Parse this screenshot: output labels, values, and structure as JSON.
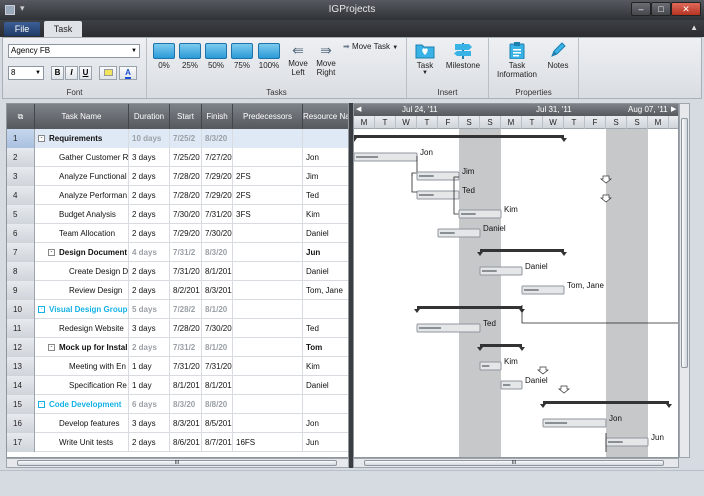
{
  "window": {
    "title": "IGProjects"
  },
  "tabs": {
    "file": "File",
    "task": "Task"
  },
  "ribbon": {
    "font": {
      "name": "Agency FB",
      "size": "8",
      "bold": "B",
      "italic": "I",
      "underline": "U",
      "group_label": "Font"
    },
    "tasks": {
      "buttons": [
        "0%",
        "25%",
        "50%",
        "75%",
        "100%"
      ],
      "move_left": [
        "Move",
        "Left"
      ],
      "move_right": [
        "Move",
        "Right"
      ],
      "move_task": "Move Task",
      "group_label": "Tasks"
    },
    "insert": {
      "task": "Task",
      "milestone": "Milestone",
      "group_label": "Insert"
    },
    "properties": {
      "task_info": [
        "Task",
        "Information"
      ],
      "notes": "Notes",
      "group_label": "Properties"
    }
  },
  "grid": {
    "columns": [
      "Task Name",
      "Duration",
      "Start",
      "Finish",
      "Predecessors",
      "Resource Na"
    ],
    "rows": [
      {
        "n": "1",
        "name": "Requirements",
        "dur": "10 days",
        "start": "7/25/2",
        "finish": "8/3/20",
        "pred": "",
        "res": "",
        "kind": "summary",
        "indent": 0,
        "exp": "-"
      },
      {
        "n": "2",
        "name": "Gather Customer R",
        "dur": "3 days",
        "start": "7/25/20",
        "finish": "7/27/20",
        "pred": "",
        "res": "Jon",
        "kind": "task",
        "indent": 1
      },
      {
        "n": "3",
        "name": "Analyze Functional",
        "dur": "2 days",
        "start": "7/28/20",
        "finish": "7/29/20",
        "pred": "2FS",
        "res": "Jim",
        "kind": "task",
        "indent": 1
      },
      {
        "n": "4",
        "name": "Analyze Performan",
        "dur": "2 days",
        "start": "7/28/20",
        "finish": "7/29/20",
        "pred": "2FS",
        "res": "Ted",
        "kind": "task",
        "indent": 1
      },
      {
        "n": "5",
        "name": "Budget Analysis",
        "dur": "2 days",
        "start": "7/30/20",
        "finish": "7/31/20",
        "pred": "3FS",
        "res": "Kim",
        "kind": "task",
        "indent": 1
      },
      {
        "n": "6",
        "name": "Team Allocation",
        "dur": "2 days",
        "start": "7/29/20",
        "finish": "7/30/20",
        "pred": "",
        "res": "Daniel",
        "kind": "task",
        "indent": 1
      },
      {
        "n": "7",
        "name": "Design Document",
        "dur": "4 days",
        "start": "7/31/2",
        "finish": "8/3/20",
        "pred": "",
        "res": "Jun",
        "kind": "summary",
        "indent": 1,
        "exp": "-"
      },
      {
        "n": "8",
        "name": "Create Design D",
        "dur": "2 days",
        "start": "7/31/20",
        "finish": "8/1/201",
        "pred": "",
        "res": "Daniel",
        "kind": "task",
        "indent": 2
      },
      {
        "n": "9",
        "name": "Review Design",
        "dur": "2 days",
        "start": "8/2/201",
        "finish": "8/3/201",
        "pred": "",
        "res": "Tom, Jane",
        "kind": "task",
        "indent": 2
      },
      {
        "n": "10",
        "name": "Visual Design Group",
        "dur": "5 days",
        "start": "7/28/2",
        "finish": "8/1/20",
        "pred": "",
        "res": "",
        "kind": "group",
        "indent": 0,
        "exp": "-"
      },
      {
        "n": "11",
        "name": "Redesign Website",
        "dur": "3 days",
        "start": "7/28/20",
        "finish": "7/30/20",
        "pred": "",
        "res": "Ted",
        "kind": "task",
        "indent": 1
      },
      {
        "n": "12",
        "name": "Mock up for Install",
        "dur": "2 days",
        "start": "7/31/2",
        "finish": "8/1/20",
        "pred": "",
        "res": "Tom",
        "kind": "summary",
        "indent": 1,
        "exp": "-"
      },
      {
        "n": "13",
        "name": "Meeting with En",
        "dur": "1 day",
        "start": "7/31/20",
        "finish": "7/31/20",
        "pred": "",
        "res": "Kim",
        "kind": "task",
        "indent": 2
      },
      {
        "n": "14",
        "name": "Specification Re",
        "dur": "1 day",
        "start": "8/1/201",
        "finish": "8/1/201",
        "pred": "",
        "res": "Daniel",
        "kind": "task",
        "indent": 2
      },
      {
        "n": "15",
        "name": "Code Development",
        "dur": "6 days",
        "start": "8/3/20",
        "finish": "8/8/20",
        "pred": "",
        "res": "",
        "kind": "group",
        "indent": 0,
        "exp": "-"
      },
      {
        "n": "16",
        "name": "Develop features",
        "dur": "3 days",
        "start": "8/3/201",
        "finish": "8/5/201",
        "pred": "",
        "res": "Jon",
        "kind": "task",
        "indent": 1
      },
      {
        "n": "17",
        "name": "Write Unit tests",
        "dur": "2 days",
        "start": "8/6/201",
        "finish": "8/7/201",
        "pred": "16FS",
        "res": "Jun",
        "kind": "task",
        "indent": 1
      }
    ]
  },
  "gantt": {
    "weeks": [
      "Jul 24, '11",
      "Jul 31, '11",
      "Aug 07, '11"
    ],
    "days": [
      "M",
      "T",
      "W",
      "T",
      "F",
      "S",
      "S",
      "M",
      "T",
      "W",
      "T",
      "F",
      "S",
      "S",
      "M"
    ],
    "labels": [
      "Jon",
      "Jim",
      "Ted",
      "Kim",
      "Daniel",
      "Jun",
      "Daniel",
      "Tom, Jane",
      "Ted",
      "Tom",
      "Kim",
      "Daniel",
      "Jon",
      "Jun"
    ]
  },
  "scroll": {
    "grip": "III"
  }
}
